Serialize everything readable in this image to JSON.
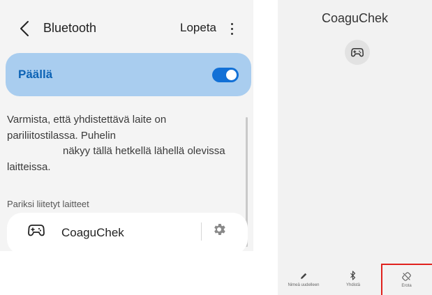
{
  "left_panel": {
    "header": {
      "back_icon": "chevron-left-icon",
      "title": "Bluetooth",
      "stop_label": "Lopeta",
      "more_icon": "more-vertical-icon"
    },
    "toggle": {
      "label": "Päällä",
      "state": "on",
      "accent": "#1270d6",
      "pill_color": "#a9cdef"
    },
    "description": {
      "line1": "Varmista, että yhdistettävä laite on",
      "line2": "pariliitostilassa. Puhelin",
      "line3": "näkyy tällä hetkellä lähellä olevissa",
      "line4": "laitteissa."
    },
    "section_title": "Pariksi liitetyt laitteet",
    "devices": [
      {
        "name": "CoaguChek",
        "icon": "gamepad-icon",
        "settings_icon": "gear-icon"
      }
    ]
  },
  "right_panel": {
    "title": "CoaguChek",
    "device_icon": "gamepad-icon",
    "actions": [
      {
        "label": "Nimeä uudelleen",
        "icon": "pencil-icon"
      },
      {
        "label": "Yhdistä",
        "icon": "bluetooth-icon"
      },
      {
        "label": "Erota",
        "icon": "unlink-icon"
      }
    ],
    "highlight_color": "#e0221e"
  }
}
